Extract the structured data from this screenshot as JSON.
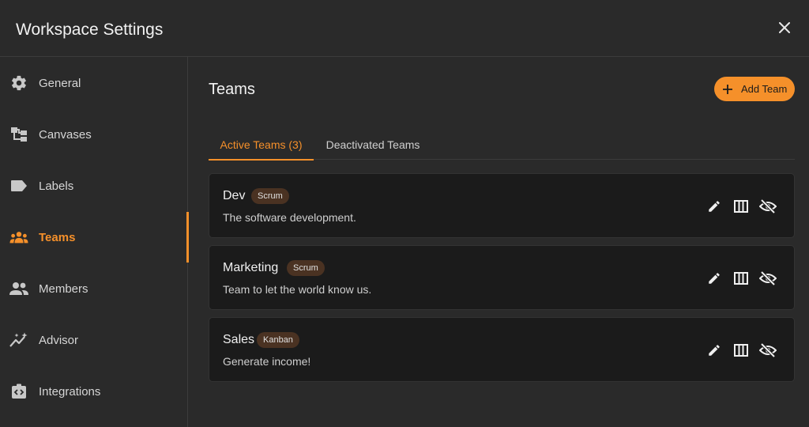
{
  "dialog": {
    "title": "Workspace Settings",
    "close_icon": "close-icon"
  },
  "sidebar": {
    "items": [
      {
        "label": "General",
        "icon": "gear-icon"
      },
      {
        "label": "Canvases",
        "icon": "canvas-icon"
      },
      {
        "label": "Labels",
        "icon": "label-icon"
      },
      {
        "label": "Teams",
        "icon": "teams-icon",
        "active": true
      },
      {
        "label": "Members",
        "icon": "members-icon"
      },
      {
        "label": "Advisor",
        "icon": "advisor-icon"
      },
      {
        "label": "Integrations",
        "icon": "integrations-icon"
      }
    ]
  },
  "main": {
    "title": "Teams",
    "add_button": {
      "label": "Add Team",
      "icon": "plus-icon"
    },
    "tabs": [
      {
        "label": "Active Teams (3)",
        "active": true
      },
      {
        "label": "Deactivated Teams",
        "active": false
      }
    ],
    "teams": [
      {
        "name": "Dev",
        "tag": "Scrum",
        "description": "The software development."
      },
      {
        "name": "Marketing",
        "tag": "Scrum",
        "description": "Team to let the world know us."
      },
      {
        "name": "Sales",
        "tag": "Kanban",
        "description": "Generate income!"
      }
    ],
    "card_actions": [
      "edit-icon",
      "board-columns-icon",
      "eye-off-icon"
    ]
  },
  "colors": {
    "accent": "#f5902a",
    "background": "#2a2a2a",
    "card": "#1b1b1b",
    "tag": "#4a3222"
  }
}
